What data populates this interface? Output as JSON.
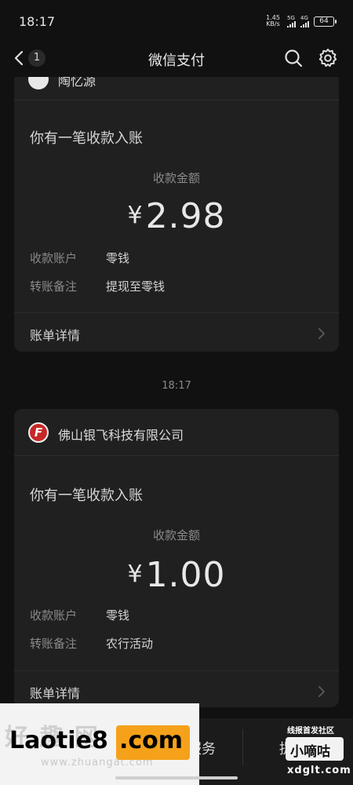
{
  "status_bar": {
    "time": "18:17",
    "net_speed_value": "1.45",
    "net_speed_unit": "KB/s",
    "sim1": "5G",
    "sim2": "4G",
    "battery": "64"
  },
  "nav": {
    "back_count": "1",
    "title": "微信支付"
  },
  "messages": [
    {
      "merchant_name": "陶忆源",
      "notice": "你有一笔收款入账",
      "amount_label": "收款金额",
      "currency": "¥",
      "amount": "2.98",
      "account_label": "收款账户",
      "account_value": "零钱",
      "remark_label": "转账备注",
      "remark_value": "提现至零钱",
      "detail_label": "账单详情"
    },
    {
      "merchant_name": "佛山银飞科技有限公司",
      "merchant_logo_letter": "F",
      "notice": "你有一笔收款入账",
      "amount_label": "收款金额",
      "currency": "¥",
      "amount": "1.00",
      "account_label": "收款账户",
      "account_value": "零钱",
      "remark_label": "转账备注",
      "remark_value": "农行活动",
      "detail_label": "账单详情"
    }
  ],
  "timestamp": "18:17",
  "bottom_menu": {
    "item2_label": "服务",
    "item3_label": "提"
  },
  "watermarks": {
    "left_ghost": "好 趣 网",
    "left_ghost_url": "www.zhuangat.com",
    "left_main": "Laotie8",
    "left_com": ".com",
    "right_top": "线报首发社区",
    "right_badge": "小嘀咕",
    "right_url": "xdglt.com"
  },
  "colors": {
    "background": "#111111",
    "card": "#202020",
    "logo_red": "#c62828",
    "watermark_orange": "#f5a11a"
  }
}
